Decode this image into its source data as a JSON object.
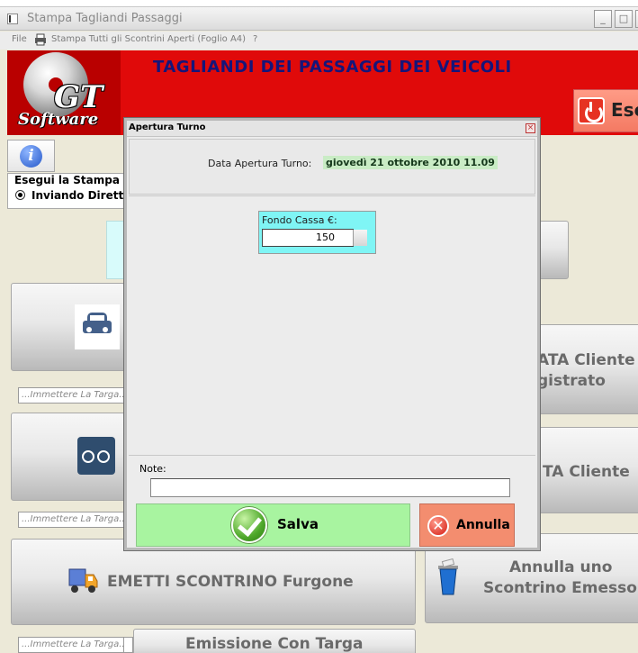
{
  "window": {
    "title": "Stampa Tagliandi Passaggi",
    "buttons": {
      "minimize": "_",
      "maximize": "□",
      "close": "×"
    }
  },
  "menu": {
    "file": "File",
    "print_all": "Stampa Tutti gli Scontrini Aperti (Foglio A4)",
    "help": "?"
  },
  "banner": {
    "logo_gt": "GT",
    "logo_software": "Software",
    "title": "TAGLIANDI DEI PASSAGGI DEI VEICOLI",
    "exit_label": "Esc"
  },
  "print_options": {
    "title": "Esegui la Stampa d",
    "option": "Inviando Dirett"
  },
  "targa_placeholder": "...Immettere La Targa...",
  "buttons_bg": {
    "cliente_registrato_line1": "ATA Cliente",
    "cliente_registrato_line2": "gistrato",
    "cliente_line": "TA Cliente",
    "emetti_furgone": "EMETTI SCONTRINO Furgone",
    "annulla_uno_line1": "Annulla uno",
    "annulla_uno_line2": "Scontrino Emesso",
    "emissione_targa": "Emissione Con Targa"
  },
  "dialog": {
    "title": "Apertura Turno",
    "close": "×",
    "data_label": "Data Apertura Turno:",
    "data_value": "giovedì 21 ottobre 2010 11.09",
    "fondo_label": "Fondo Cassa €:",
    "fondo_value": "150",
    "note_label": "Note:",
    "note_value": "",
    "save_label": "Salva",
    "cancel_label": "Annulla"
  }
}
